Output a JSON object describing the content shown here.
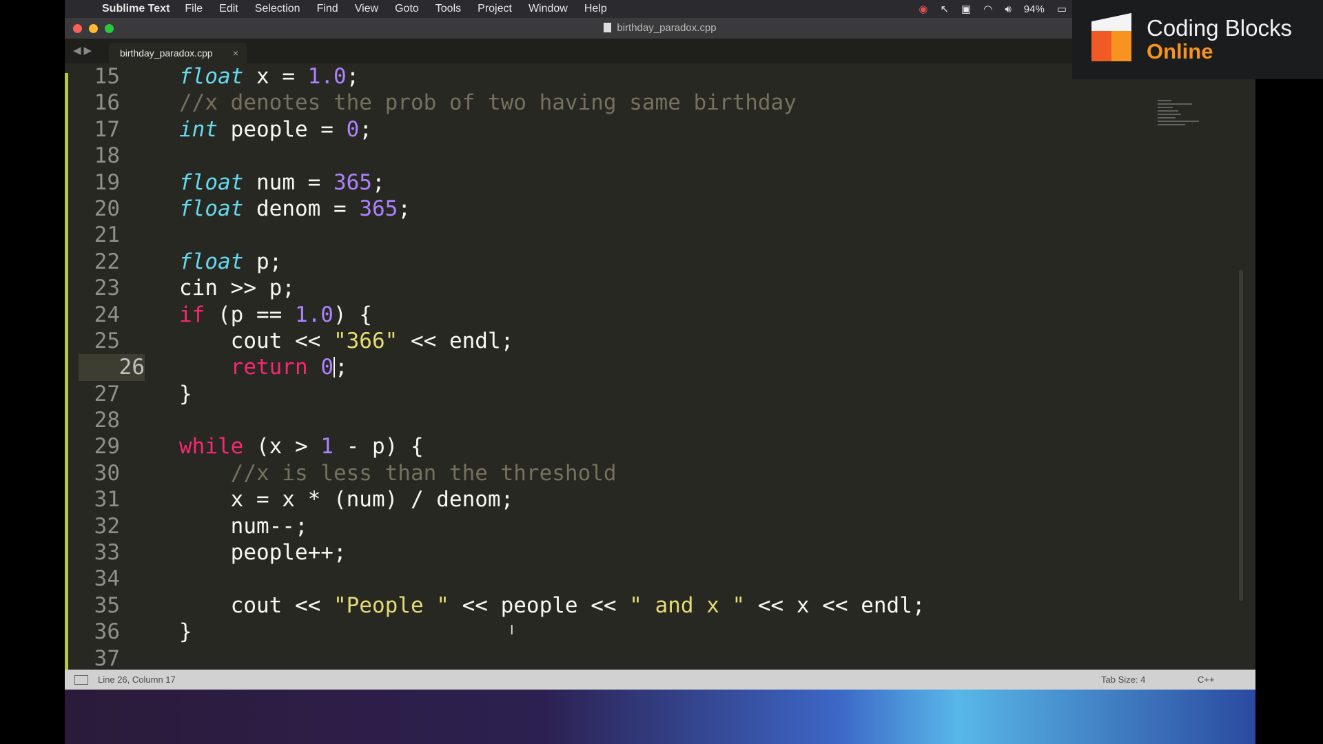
{
  "menubar": {
    "app_name": "Sublime Text",
    "items": [
      "File",
      "Edit",
      "Selection",
      "Find",
      "View",
      "Goto",
      "Tools",
      "Project",
      "Window",
      "Help"
    ],
    "battery": "94%"
  },
  "window": {
    "title": "birthday_paradox.cpp",
    "tab_label": "birthday_paradox.cpp",
    "tab_close": "×"
  },
  "editor": {
    "line_numbers": [
      "15",
      "16",
      "17",
      "18",
      "19",
      "20",
      "21",
      "22",
      "23",
      "24",
      "25",
      "26",
      "27",
      "28",
      "29",
      "30",
      "31",
      "32",
      "33",
      "34",
      "35",
      "36",
      "37"
    ],
    "current_line": "26"
  },
  "status": {
    "position": "Line 26, Column 17",
    "tab_size": "Tab Size: 4",
    "syntax": "C++"
  },
  "brand": {
    "line1": "Coding Blocks",
    "line2": "Online"
  },
  "colors": {
    "background": "#272822",
    "keyword": "#f92672",
    "type": "#66d9ef",
    "number": "#ae81ff",
    "string": "#e6db74",
    "comment": "#75715e",
    "brand_orange": "#f7931e"
  }
}
